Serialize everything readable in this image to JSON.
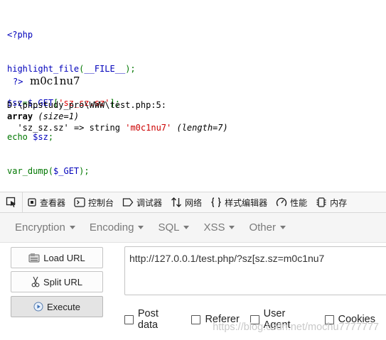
{
  "source": {
    "open_tag": "<?php",
    "line2": {
      "fn": "highlight_file",
      "open": "(",
      "const": "__FILE__",
      "close": ");"
    },
    "line3": {
      "var": "$sz",
      "eq": "=",
      "get": "$_GET",
      "lb": "[",
      "key": "'sz_sz.sz'",
      "rb": "];"
    },
    "line4": {
      "kw": "echo ",
      "var": "$sz",
      "semi": ";"
    },
    "line5": {
      "fn": "var_dump",
      "open": "(",
      "arg": "$_GET",
      "close": ");"
    }
  },
  "echo_output": {
    "close_tag": "?>",
    "value": "m0c1nu7"
  },
  "var_dump": {
    "location": "D:\\phpstudy_pro\\WWW\\test.php:5:",
    "type": "array",
    "size": "(size=1)",
    "key": "'sz_sz.sz'",
    "arrow": "=>",
    "vtype": "string",
    "value": "'m0c1nu7'",
    "length": "(length=7)"
  },
  "devtools": {
    "tabs": [
      {
        "icon": "inspector-icon",
        "label": "查看器"
      },
      {
        "icon": "console-icon",
        "label": "控制台"
      },
      {
        "icon": "debugger-icon",
        "label": "调试器"
      },
      {
        "icon": "network-icon",
        "label": "网络"
      },
      {
        "icon": "style-editor-icon",
        "label": "样式编辑器"
      },
      {
        "icon": "performance-icon",
        "label": "性能"
      },
      {
        "icon": "memory-icon",
        "label": "内存"
      }
    ]
  },
  "hackbar": {
    "menu": [
      "Encryption",
      "Encoding",
      "SQL",
      "XSS",
      "Other"
    ],
    "buttons": {
      "load": "Load URL",
      "split": "Split URL",
      "execute": "Execute"
    },
    "url": "http://127.0.0.1/test.php/?sz[sz.sz=m0c1nu7",
    "options": [
      "Post data",
      "Referer",
      "User Agent",
      "Cookies"
    ]
  },
  "watermark": "https://blog.csdn.net/mochu7777777"
}
